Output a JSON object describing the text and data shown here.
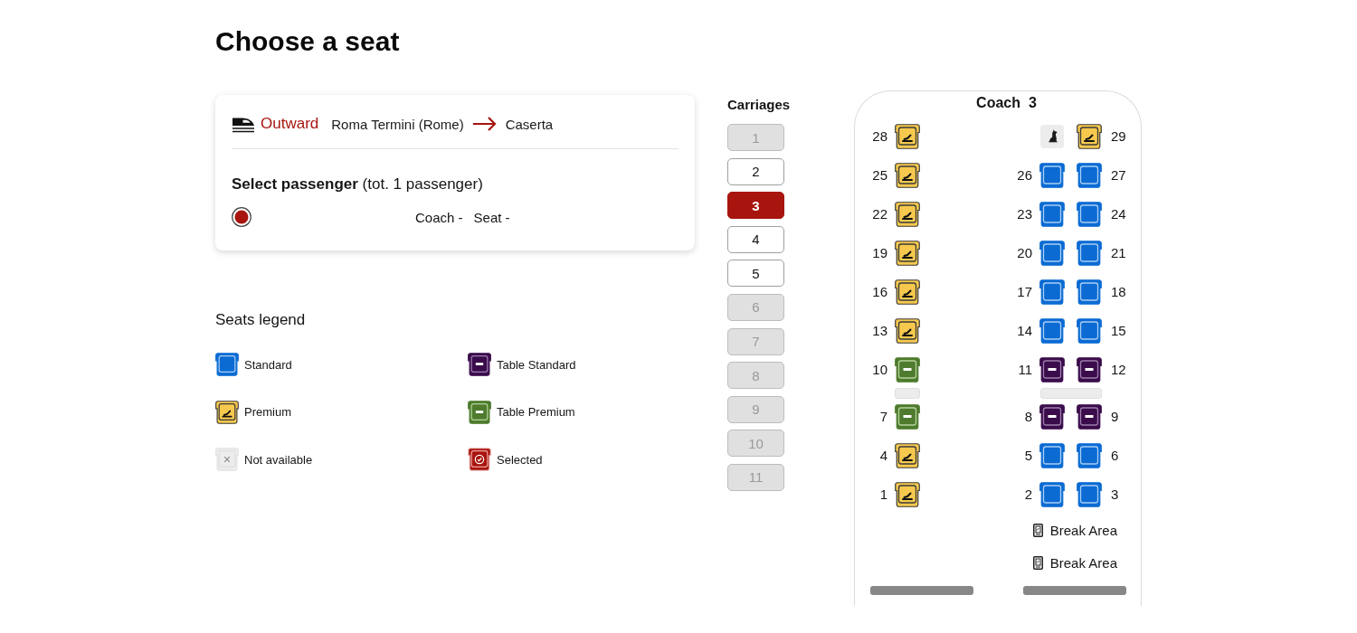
{
  "title": "Choose a seat",
  "journey": {
    "direction": "Outward",
    "from": "Roma Termini (Rome)",
    "to": "Caserta"
  },
  "passengers": {
    "heading": "**Select passenger** (tot. 1 passenger)",
    "items": [
      {
        "selected": true,
        "coach": "Coach -",
        "seat": "Seat -"
      }
    ]
  },
  "legend": {
    "title": "Seats legend",
    "items": [
      {
        "kind": "standard",
        "label": "Standard"
      },
      {
        "kind": "table_standard",
        "label": "Table Standard"
      },
      {
        "kind": "premium",
        "label": "Premium"
      },
      {
        "kind": "table_premium",
        "label": "Table Premium"
      },
      {
        "kind": "unavailable",
        "label": "Not available"
      },
      {
        "kind": "selected",
        "label": "Selected"
      }
    ]
  },
  "carriages": {
    "title": "Carriages",
    "items": [
      {
        "label": "1",
        "selected": false,
        "disabled": true
      },
      {
        "label": "2",
        "selected": false,
        "disabled": false
      },
      {
        "label": "3",
        "selected": true,
        "disabled": false
      },
      {
        "label": "4",
        "selected": false,
        "disabled": false
      },
      {
        "label": "5",
        "selected": false,
        "disabled": false
      },
      {
        "label": "6",
        "selected": false,
        "disabled": true
      },
      {
        "label": "7",
        "selected": false,
        "disabled": true
      },
      {
        "label": "8",
        "selected": false,
        "disabled": true
      },
      {
        "label": "9",
        "selected": false,
        "disabled": true
      },
      {
        "label": "10",
        "selected": false,
        "disabled": true
      },
      {
        "label": "11",
        "selected": false,
        "disabled": true
      }
    ]
  },
  "coach": {
    "label": "Coach",
    "number": "3",
    "rows": [
      {
        "kind": "seats",
        "left": {
          "kind": "premium",
          "number": "28"
        },
        "right": [
          {
            "kind": "pet"
          },
          {
            "kind": "premium",
            "number": "29"
          }
        ]
      },
      {
        "kind": "seats",
        "left": {
          "kind": "premium",
          "number": "25"
        },
        "right": [
          {
            "kind": "standard",
            "number": "26"
          },
          {
            "kind": "standard",
            "number": "27"
          }
        ]
      },
      {
        "kind": "seats",
        "left": {
          "kind": "premium",
          "number": "22"
        },
        "right": [
          {
            "kind": "standard",
            "number": "23"
          },
          {
            "kind": "standard",
            "number": "24"
          }
        ]
      },
      {
        "kind": "seats",
        "left": {
          "kind": "premium",
          "number": "19"
        },
        "right": [
          {
            "kind": "standard",
            "number": "20"
          },
          {
            "kind": "standard",
            "number": "21"
          }
        ]
      },
      {
        "kind": "seats",
        "left": {
          "kind": "premium",
          "number": "16"
        },
        "right": [
          {
            "kind": "standard",
            "number": "17"
          },
          {
            "kind": "standard",
            "number": "18"
          }
        ]
      },
      {
        "kind": "seats",
        "left": {
          "kind": "premium",
          "number": "13"
        },
        "right": [
          {
            "kind": "standard",
            "number": "14"
          },
          {
            "kind": "standard",
            "number": "15"
          }
        ]
      },
      {
        "kind": "seats",
        "left": {
          "kind": "table_premium",
          "number": "10"
        },
        "right": [
          {
            "kind": "table_standard",
            "number": "11"
          },
          {
            "kind": "table_standard",
            "number": "12"
          }
        ]
      },
      {
        "kind": "tables"
      },
      {
        "kind": "seats",
        "left": {
          "kind": "table_premium",
          "number": "7"
        },
        "right": [
          {
            "kind": "table_standard",
            "number": "8"
          },
          {
            "kind": "table_standard",
            "number": "9"
          }
        ]
      },
      {
        "kind": "seats",
        "left": {
          "kind": "premium",
          "number": "4"
        },
        "right": [
          {
            "kind": "standard",
            "number": "5"
          },
          {
            "kind": "standard",
            "number": "6"
          }
        ]
      },
      {
        "kind": "seats",
        "left": {
          "kind": "premium",
          "number": "1"
        },
        "right": [
          {
            "kind": "standard",
            "number": "2"
          },
          {
            "kind": "standard",
            "number": "3"
          }
        ]
      }
    ],
    "facilities": [
      {
        "label": "Break Area"
      },
      {
        "label": "Break Area"
      }
    ]
  }
}
